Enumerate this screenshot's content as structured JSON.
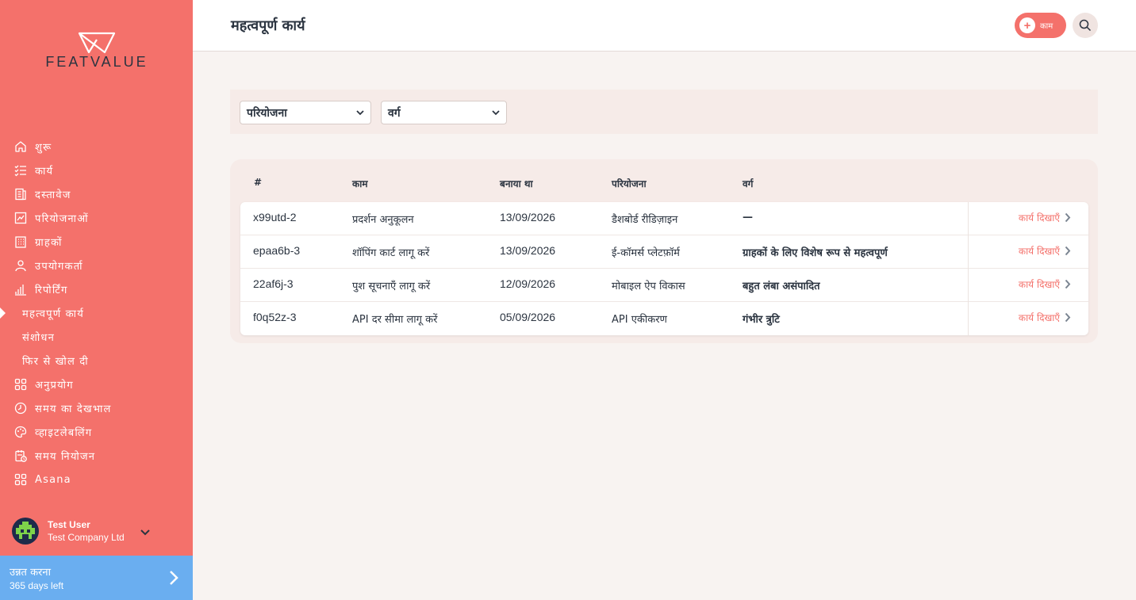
{
  "brand": {
    "logo_text": "FEATVALUE"
  },
  "sidebar": {
    "items": [
      {
        "label": "शुरू",
        "icon": "home-icon"
      },
      {
        "label": "कार्य",
        "icon": "checklist-icon"
      },
      {
        "label": "दस्तावेज",
        "icon": "document-icon"
      },
      {
        "label": "परियोजनाओं",
        "icon": "chart-icon"
      },
      {
        "label": "ग्राहकों",
        "icon": "building-icon"
      },
      {
        "label": "उपयोगकर्ता",
        "icon": "user-icon"
      },
      {
        "label": "रिपोर्टिंग",
        "icon": "bar-chart-icon"
      },
      {
        "label": "महत्वपूर्ण कार्य",
        "sub": true,
        "active": true
      },
      {
        "label": "संशोधन",
        "sub": true
      },
      {
        "label": "फिर से खोल दी",
        "sub": true
      },
      {
        "label": "अनुप्रयोग",
        "icon": "apps-icon"
      },
      {
        "label": "समय का देखभाल",
        "icon": "timer-icon"
      },
      {
        "label": "व्हाइटलेबलिंग",
        "icon": "palette-icon"
      },
      {
        "label": "समय नियोजन",
        "icon": "calendar-clock-icon"
      },
      {
        "label": "Asana",
        "icon": "apps-icon"
      }
    ],
    "user": {
      "name": "Test User",
      "company": "Test Company Ltd"
    },
    "upgrade": {
      "title": "उन्नत करना",
      "subtitle": "365 days left"
    }
  },
  "header": {
    "title": "महत्वपूर्ण कार्य",
    "add_label": "काम"
  },
  "filters": {
    "project": "परियोजना",
    "category": "वर्ग"
  },
  "table": {
    "headers": [
      "#",
      "काम",
      "बनाया था",
      "परियोजना",
      "वर्ग"
    ],
    "action_label": "कार्य दिखाएँ",
    "rows": [
      {
        "id": "x99utd-2",
        "task": "प्रदर्शन अनुकूलन",
        "created": "13/09/2026",
        "project": "डैशबोर्ड रीडिज़ाइन",
        "category": "—"
      },
      {
        "id": "epaa6b-3",
        "task": "शॉपिंग कार्ट लागू करें",
        "created": "13/09/2026",
        "project": "ई-कॉमर्स प्लेटफ़ॉर्म",
        "category": "ग्राहकों के लिए विशेष रूप से महत्वपूर्ण"
      },
      {
        "id": "22af6j-3",
        "task": "पुश सूचनाएँ लागू करें",
        "created": "12/09/2026",
        "project": "मोबाइल ऐप विकास",
        "category": "बहुत लंबा असंपादित"
      },
      {
        "id": "f0q52z-3",
        "task": "API दर सीमा लागू करें",
        "created": "05/09/2026",
        "project": "API एकीकरण",
        "category": "गंभीर त्रुटि"
      }
    ]
  },
  "colors": {
    "accent": "#f4716b",
    "upgrade": "#6aaef0",
    "text": "#2b3440"
  }
}
